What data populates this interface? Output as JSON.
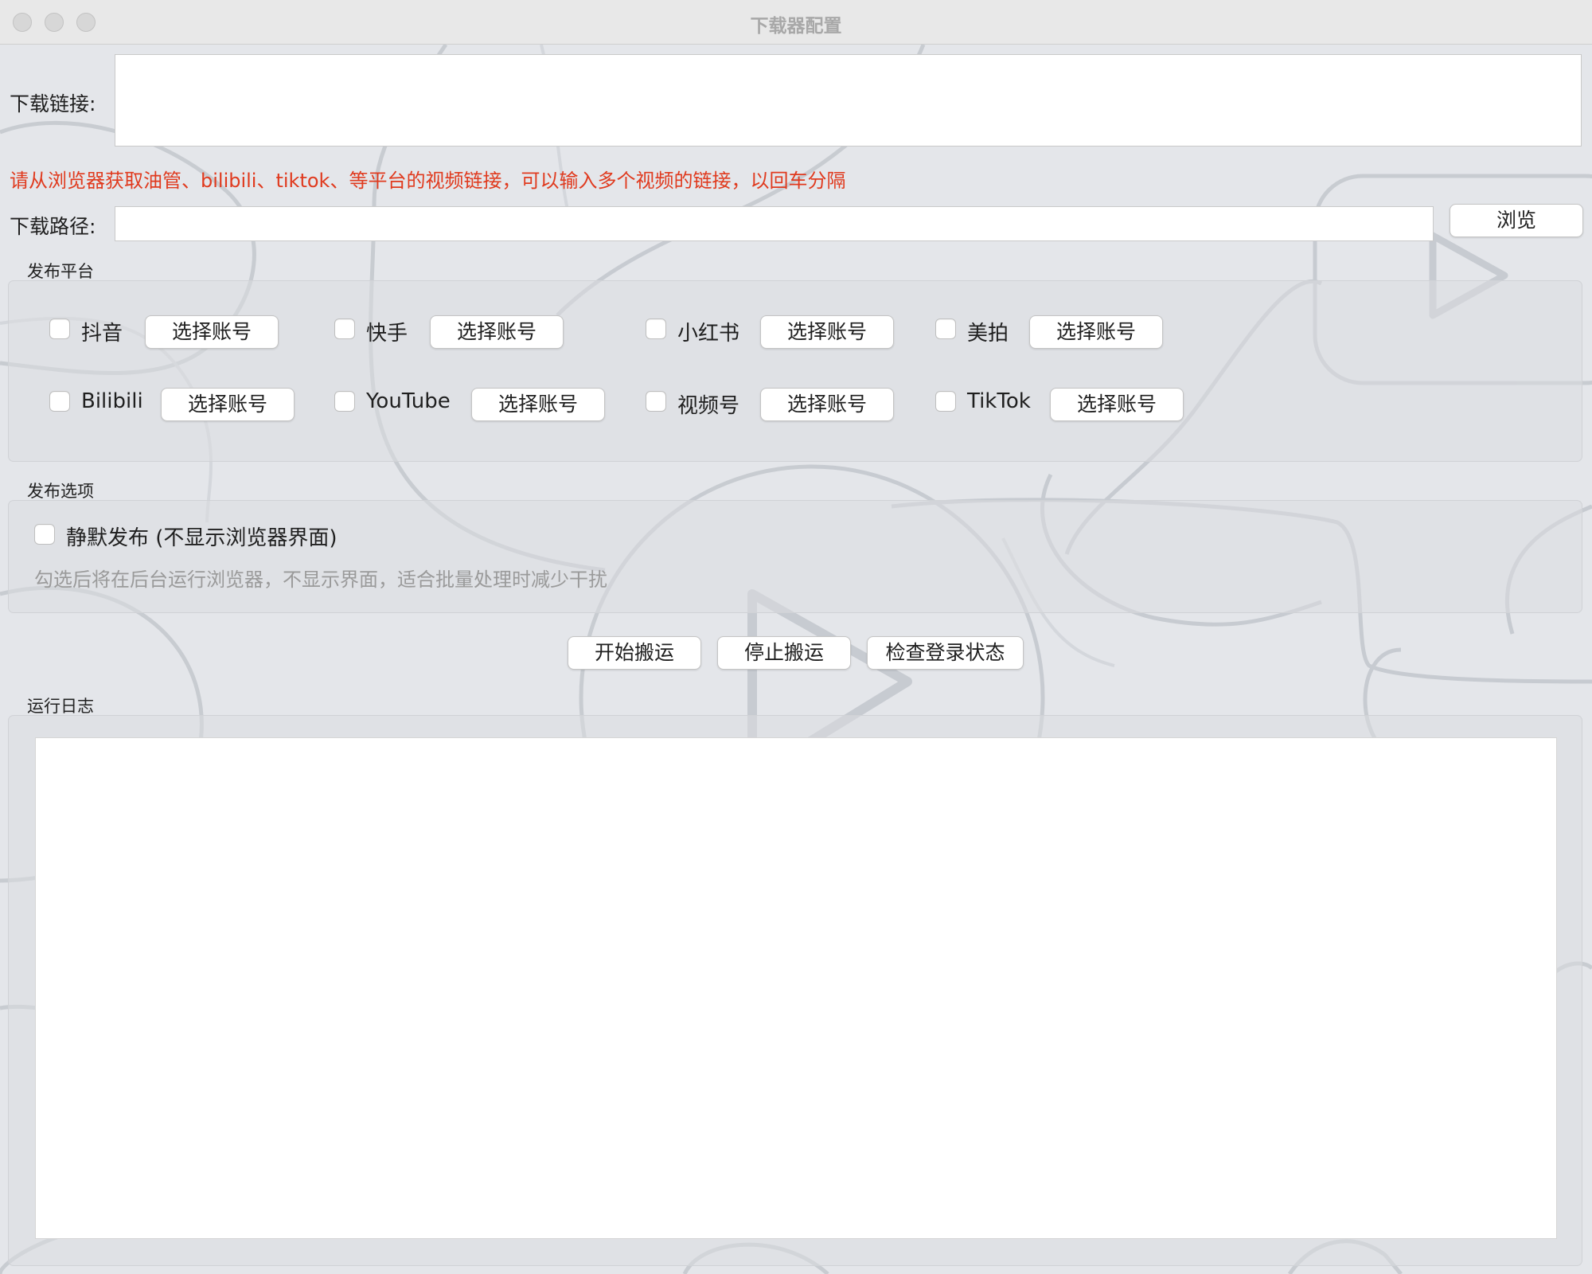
{
  "window": {
    "title": "下载器配置"
  },
  "download": {
    "link_label": "下载链接:",
    "link_value": "",
    "hint": "请从浏览器获取油管、bilibili、tiktok、等平台的视频链接，可以输入多个视频的链接，以回车分隔",
    "hint_color": "#e03a1e",
    "path_label": "下载路径:",
    "path_value": "",
    "browse_label": "浏览"
  },
  "platforms": {
    "title": "发布平台",
    "select_account_label": "选择账号",
    "items": [
      {
        "name": "抖音",
        "checked": false
      },
      {
        "name": "快手",
        "checked": false
      },
      {
        "name": "小红书",
        "checked": false
      },
      {
        "name": "美拍",
        "checked": false
      },
      {
        "name": "Bilibili",
        "checked": false
      },
      {
        "name": "YouTube",
        "checked": false
      },
      {
        "name": "视频号",
        "checked": false
      },
      {
        "name": "TikTok",
        "checked": false
      }
    ]
  },
  "options": {
    "title": "发布选项",
    "silent_label": "静默发布 (不显示浏览器界面)",
    "silent_checked": false,
    "silent_hint": "勾选后将在后台运行浏览器，不显示界面，适合批量处理时减少干扰"
  },
  "actions": {
    "start_label": "开始搬运",
    "stop_label": "停止搬运",
    "check_login_label": "检查登录状态"
  },
  "log": {
    "title": "运行日志",
    "content": ""
  }
}
